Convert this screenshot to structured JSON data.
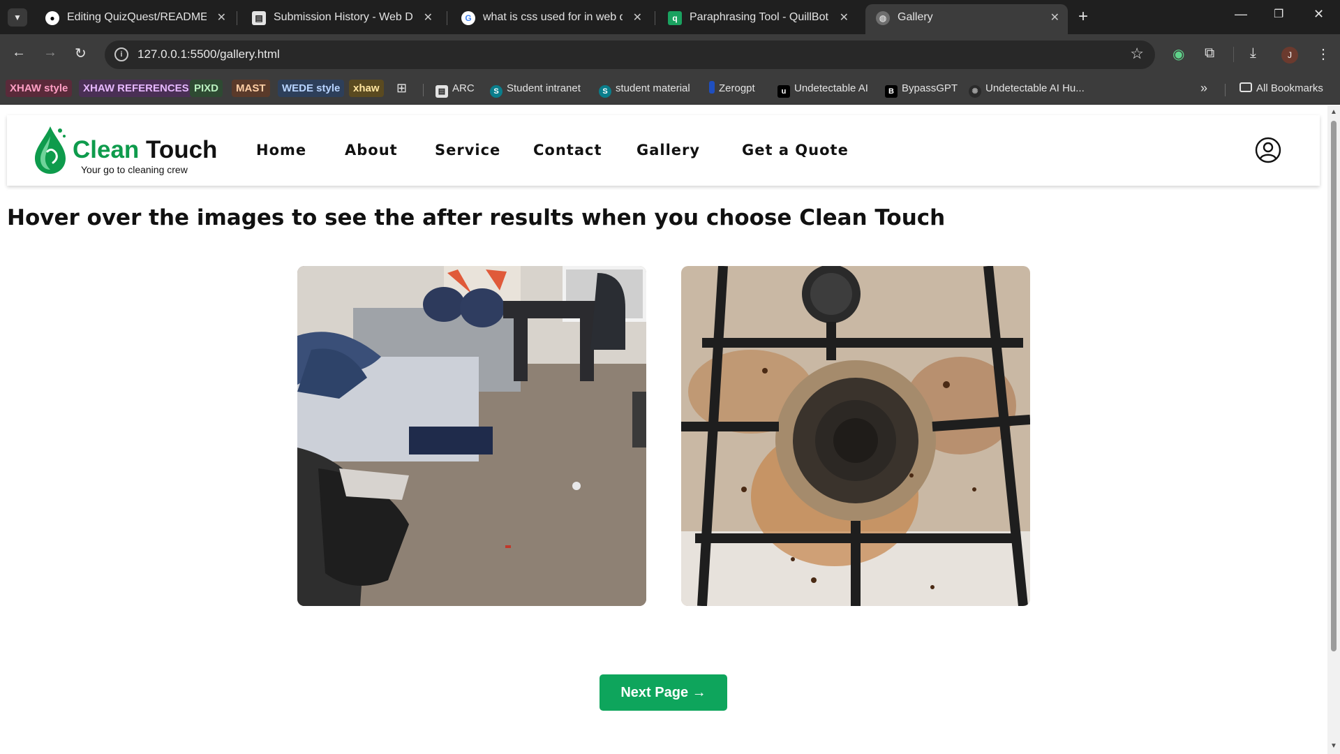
{
  "browser": {
    "tabs": [
      {
        "title": "Editing QuizQuest/README.md",
        "icon": "github-icon"
      },
      {
        "title": "Submission History - Web Deve",
        "icon": "clapper-icon"
      },
      {
        "title": "what is css used for in web deve",
        "icon": "google-icon"
      },
      {
        "title": "Paraphrasing Tool - QuillBot AI",
        "icon": "quillbot-icon"
      },
      {
        "title": "Gallery",
        "icon": "globe-icon",
        "active": true
      }
    ],
    "url": "127.0.0.1:5500/gallery.html",
    "avatar_initial": "J",
    "bookmark_chips": [
      {
        "label": "XHAW style",
        "bg": "#5a2a3a",
        "fg": "#ff9fc4"
      },
      {
        "label": "XHAW REFERENCES",
        "bg": "#4a2f55",
        "fg": "#e6b8ff"
      },
      {
        "label": "PIXD",
        "bg": "#2e4a32",
        "fg": "#b9f0bf"
      },
      {
        "label": "MAST",
        "bg": "#5a3a2a",
        "fg": "#ffcfa6"
      },
      {
        "label": "WEDE style",
        "bg": "#2d3f5a",
        "fg": "#b8d4ff"
      },
      {
        "label": "xhaw",
        "bg": "#5a4a20",
        "fg": "#ffe5a0"
      }
    ],
    "bookmarks": [
      {
        "label": "ARC",
        "icon": "clapper-icon"
      },
      {
        "label": "Student intranet",
        "icon": "sharepoint-icon"
      },
      {
        "label": "student material",
        "icon": "sharepoint-icon"
      },
      {
        "label": "Zerogpt",
        "icon": "zerogpt-icon"
      },
      {
        "label": "Undetectable AI",
        "icon": "undetectable-icon"
      },
      {
        "label": "BypassGPT",
        "icon": "bypassgpt-icon"
      },
      {
        "label": "Undetectable AI Hu...",
        "icon": "openai-icon"
      }
    ],
    "all_bookmarks_label": "All Bookmarks"
  },
  "site": {
    "logo_word1": "Clean",
    "logo_word2": "Touch",
    "tagline": "Your go to cleaning crew",
    "nav": [
      "Home",
      "About",
      "Service",
      "Contact",
      "Gallery",
      "Get a Quote"
    ],
    "headline": "Hover over the images to see the after results when you choose Clean Touch",
    "images": [
      {
        "name": "messy-bedroom-image",
        "alt": "Messy bedroom with clothes on bed"
      },
      {
        "name": "dirty-stove-image",
        "alt": "Dirty gas stove burner"
      }
    ],
    "next_button": "Next Page →",
    "accent_color": "#0ea55c"
  }
}
